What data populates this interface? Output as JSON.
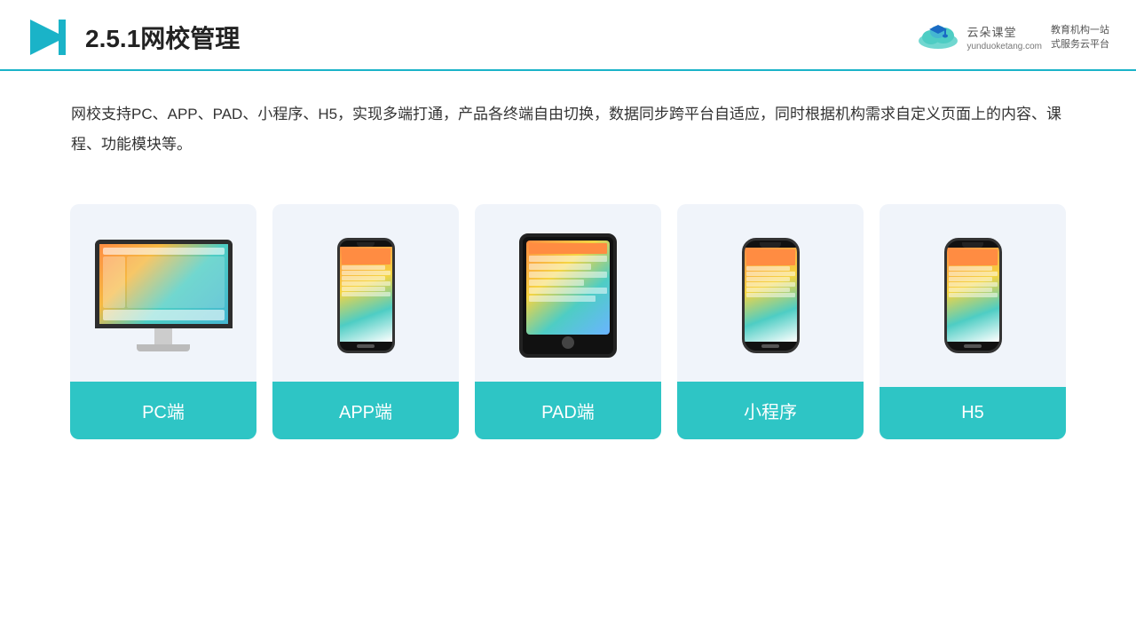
{
  "header": {
    "title": "2.5.1网校管理",
    "logo_brand": "云朵课堂",
    "logo_url_text": "yunduoketang.com",
    "logo_tagline_line1": "教育机构一站",
    "logo_tagline_line2": "式服务云平台"
  },
  "description": {
    "text": "网校支持PC、APP、PAD、小程序、H5，实现多端打通，产品各终端自由切换，数据同步跨平台自适应，同时根据机构需求自定义页面上的内容、课程、功能模块等。"
  },
  "cards": [
    {
      "id": "pc",
      "label": "PC端",
      "device": "pc"
    },
    {
      "id": "app",
      "label": "APP端",
      "device": "phone"
    },
    {
      "id": "pad",
      "label": "PAD端",
      "device": "tablet"
    },
    {
      "id": "mini",
      "label": "小程序",
      "device": "phone"
    },
    {
      "id": "h5",
      "label": "H5",
      "device": "phone"
    }
  ]
}
